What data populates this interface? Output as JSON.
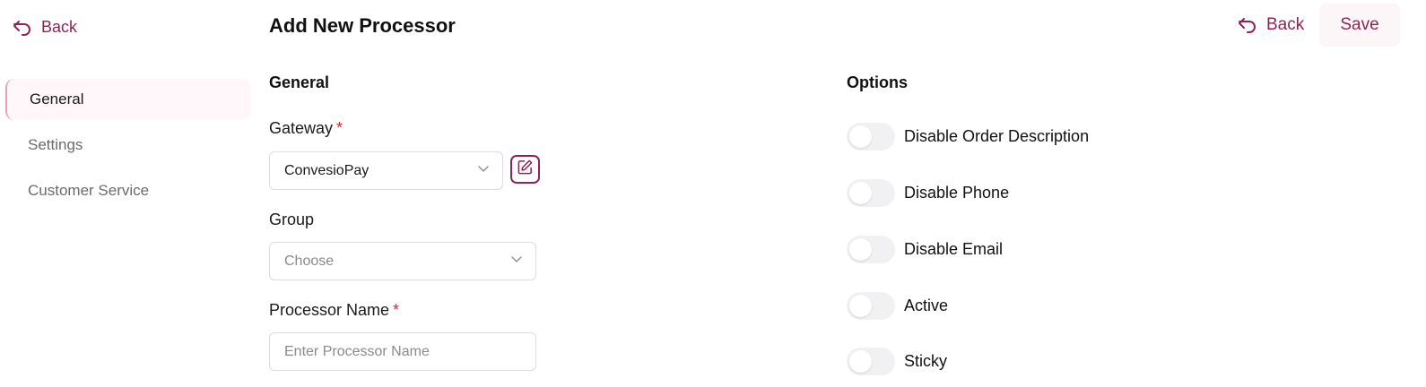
{
  "nav": {
    "back_label": "Back"
  },
  "header": {
    "title": "Add New Processor",
    "back_label": "Back",
    "save_label": "Save"
  },
  "sidebar": {
    "items": [
      {
        "label": "General",
        "active": true
      },
      {
        "label": "Settings",
        "active": false
      },
      {
        "label": "Customer Service",
        "active": false
      }
    ]
  },
  "general": {
    "title": "General",
    "gateway": {
      "label": "Gateway",
      "required_mark": "*",
      "value": "ConvesioPay"
    },
    "group": {
      "label": "Group",
      "placeholder": "Choose"
    },
    "processor_name": {
      "label": "Processor Name",
      "required_mark": "*",
      "placeholder": "Enter Processor Name",
      "value": ""
    }
  },
  "options": {
    "title": "Options",
    "items": [
      {
        "label": "Disable Order Description",
        "enabled": false
      },
      {
        "label": "Disable Phone",
        "enabled": false
      },
      {
        "label": "Disable Email",
        "enabled": false
      },
      {
        "label": "Active",
        "enabled": false
      },
      {
        "label": "Sticky",
        "enabled": false
      }
    ]
  },
  "colors": {
    "accent": "#8e2455",
    "required": "#d8283e",
    "toggle_off": "#f1f1f3"
  },
  "icons": {
    "back": "back-arrow-icon",
    "chevron": "chevron-down-icon",
    "edit": "edit-pencil-icon"
  }
}
